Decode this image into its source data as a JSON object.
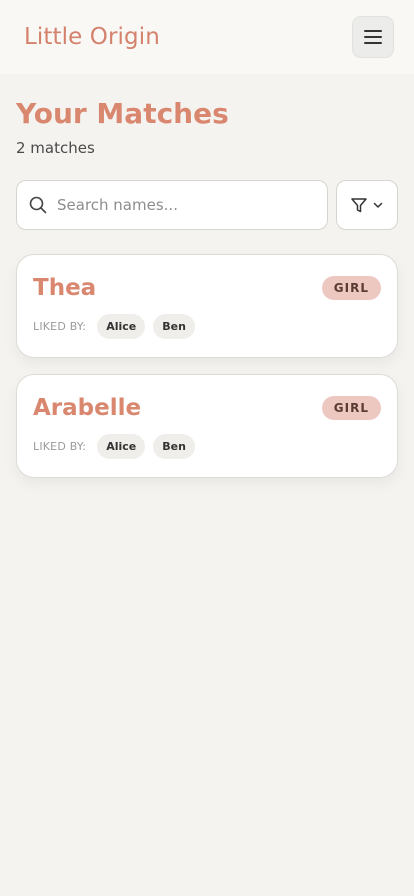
{
  "header": {
    "brand": "Little Origin",
    "menu_icon": "hamburger-icon"
  },
  "main": {
    "title": "Your Matches",
    "count": "2 matches",
    "search": {
      "placeholder": "Search names...",
      "icon": "search-icon"
    },
    "filter": {
      "icon": "filter-icon",
      "caret_icon": "chevron-down-icon"
    },
    "matches": [
      {
        "name": "Thea",
        "gender": "GIRL",
        "liked_label": "LIKED BY:",
        "liked_by": [
          "Alice",
          "Ben"
        ]
      },
      {
        "name": "Arabelle",
        "gender": "GIRL",
        "liked_label": "LIKED BY:",
        "liked_by": [
          "Alice",
          "Ben"
        ]
      }
    ]
  },
  "colors": {
    "accent": "#d9876f",
    "background": "#f4f3ef",
    "badge_bg": "#ecc8c0"
  }
}
